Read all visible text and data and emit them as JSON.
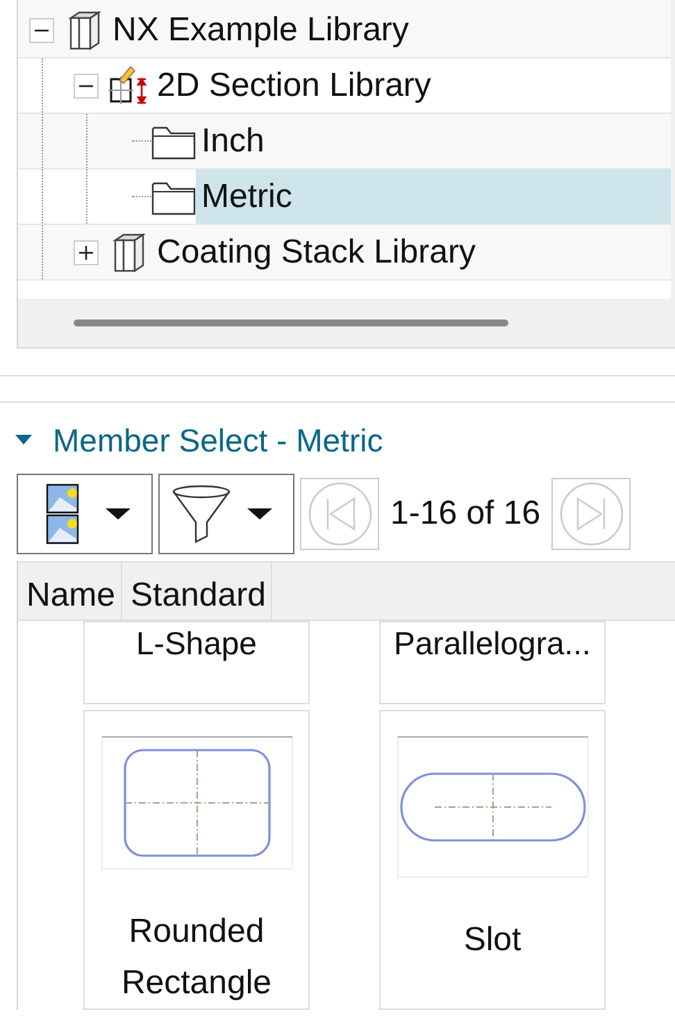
{
  "tree": [
    {
      "label": "NX Example Library",
      "kind": "library",
      "expanded": true,
      "selected": false,
      "children": [
        {
          "label": "2D Section Library",
          "kind": "section",
          "expanded": true,
          "selected": false,
          "children": [
            {
              "label": "Inch",
              "kind": "folder",
              "selected": false
            },
            {
              "label": "Metric",
              "kind": "folder",
              "selected": true
            }
          ]
        },
        {
          "label": "Coating Stack Library",
          "kind": "library",
          "expanded": false,
          "selected": false
        }
      ]
    }
  ],
  "member_select": {
    "title": "Member Select - Metric",
    "expanded": true,
    "toolbar": {
      "prev_disabled": true,
      "range": "1-16 of 16",
      "next_disabled": true
    },
    "columns": [
      "Name",
      "Standard"
    ],
    "members": [
      {
        "name": "L-Shape",
        "kind": "hidden"
      },
      {
        "name": "Parallelogra...",
        "kind": "hidden"
      },
      {
        "name": "Rounded Rectangle",
        "kind": "rounded_rectangle"
      },
      {
        "name": "Slot",
        "kind": "slot"
      }
    ]
  }
}
